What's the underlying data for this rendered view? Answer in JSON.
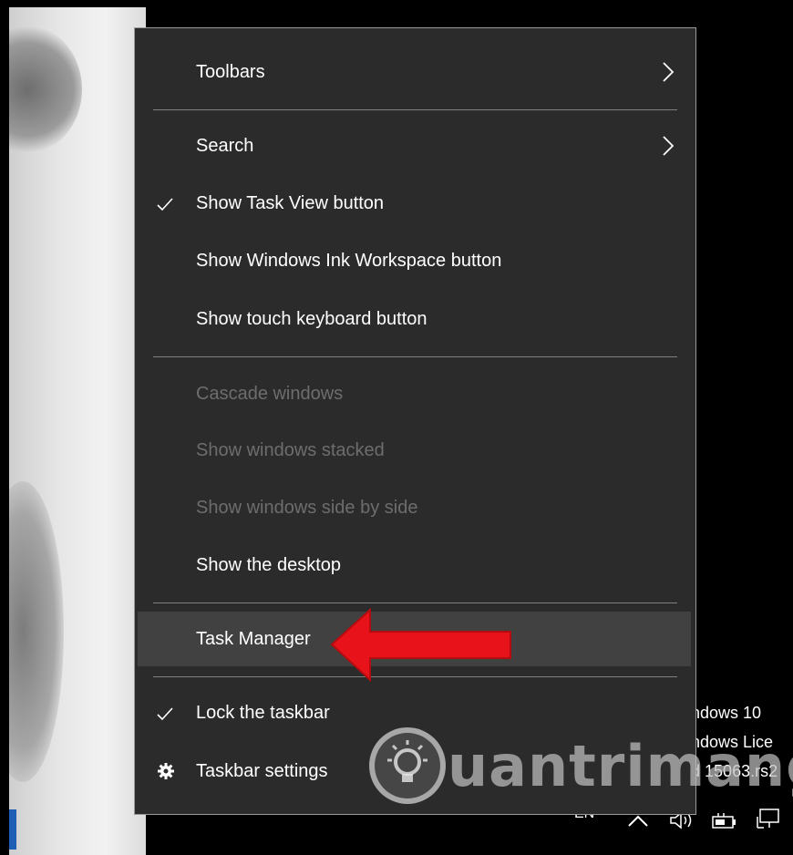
{
  "menu": {
    "items": [
      {
        "label": "Toolbars",
        "submenu": true,
        "checked": false,
        "enabled": true
      },
      {
        "label": "Search",
        "submenu": true,
        "checked": false,
        "enabled": true
      },
      {
        "label": "Show Task View button",
        "submenu": false,
        "checked": true,
        "enabled": true
      },
      {
        "label": "Show Windows Ink Workspace button",
        "submenu": false,
        "checked": false,
        "enabled": true
      },
      {
        "label": "Show touch keyboard button",
        "submenu": false,
        "checked": false,
        "enabled": true
      },
      {
        "label": "Cascade windows",
        "submenu": false,
        "checked": false,
        "enabled": false
      },
      {
        "label": "Show windows stacked",
        "submenu": false,
        "checked": false,
        "enabled": false
      },
      {
        "label": "Show windows side by side",
        "submenu": false,
        "checked": false,
        "enabled": false
      },
      {
        "label": "Show the desktop",
        "submenu": false,
        "checked": false,
        "enabled": true
      },
      {
        "label": "Task Manager",
        "submenu": false,
        "checked": false,
        "enabled": true,
        "highlighted": true
      },
      {
        "label": "Lock the taskbar",
        "submenu": false,
        "checked": true,
        "enabled": true
      },
      {
        "label": "Taskbar settings",
        "submenu": false,
        "checked": false,
        "enabled": true,
        "icon": "gear-icon"
      }
    ]
  },
  "activation": {
    "line1": "ndows 10",
    "line2": "ndows Lice",
    "line3": "15063.rs2",
    "line3_prefix": "d"
  },
  "tray": {
    "language": "EN"
  },
  "watermark": {
    "text": "uantrimang"
  },
  "colors": {
    "menu_bg": "#2b2b2b",
    "highlight_bg": "#414141",
    "disabled_text": "#6d6d6d",
    "arrow": "#e8131a"
  }
}
